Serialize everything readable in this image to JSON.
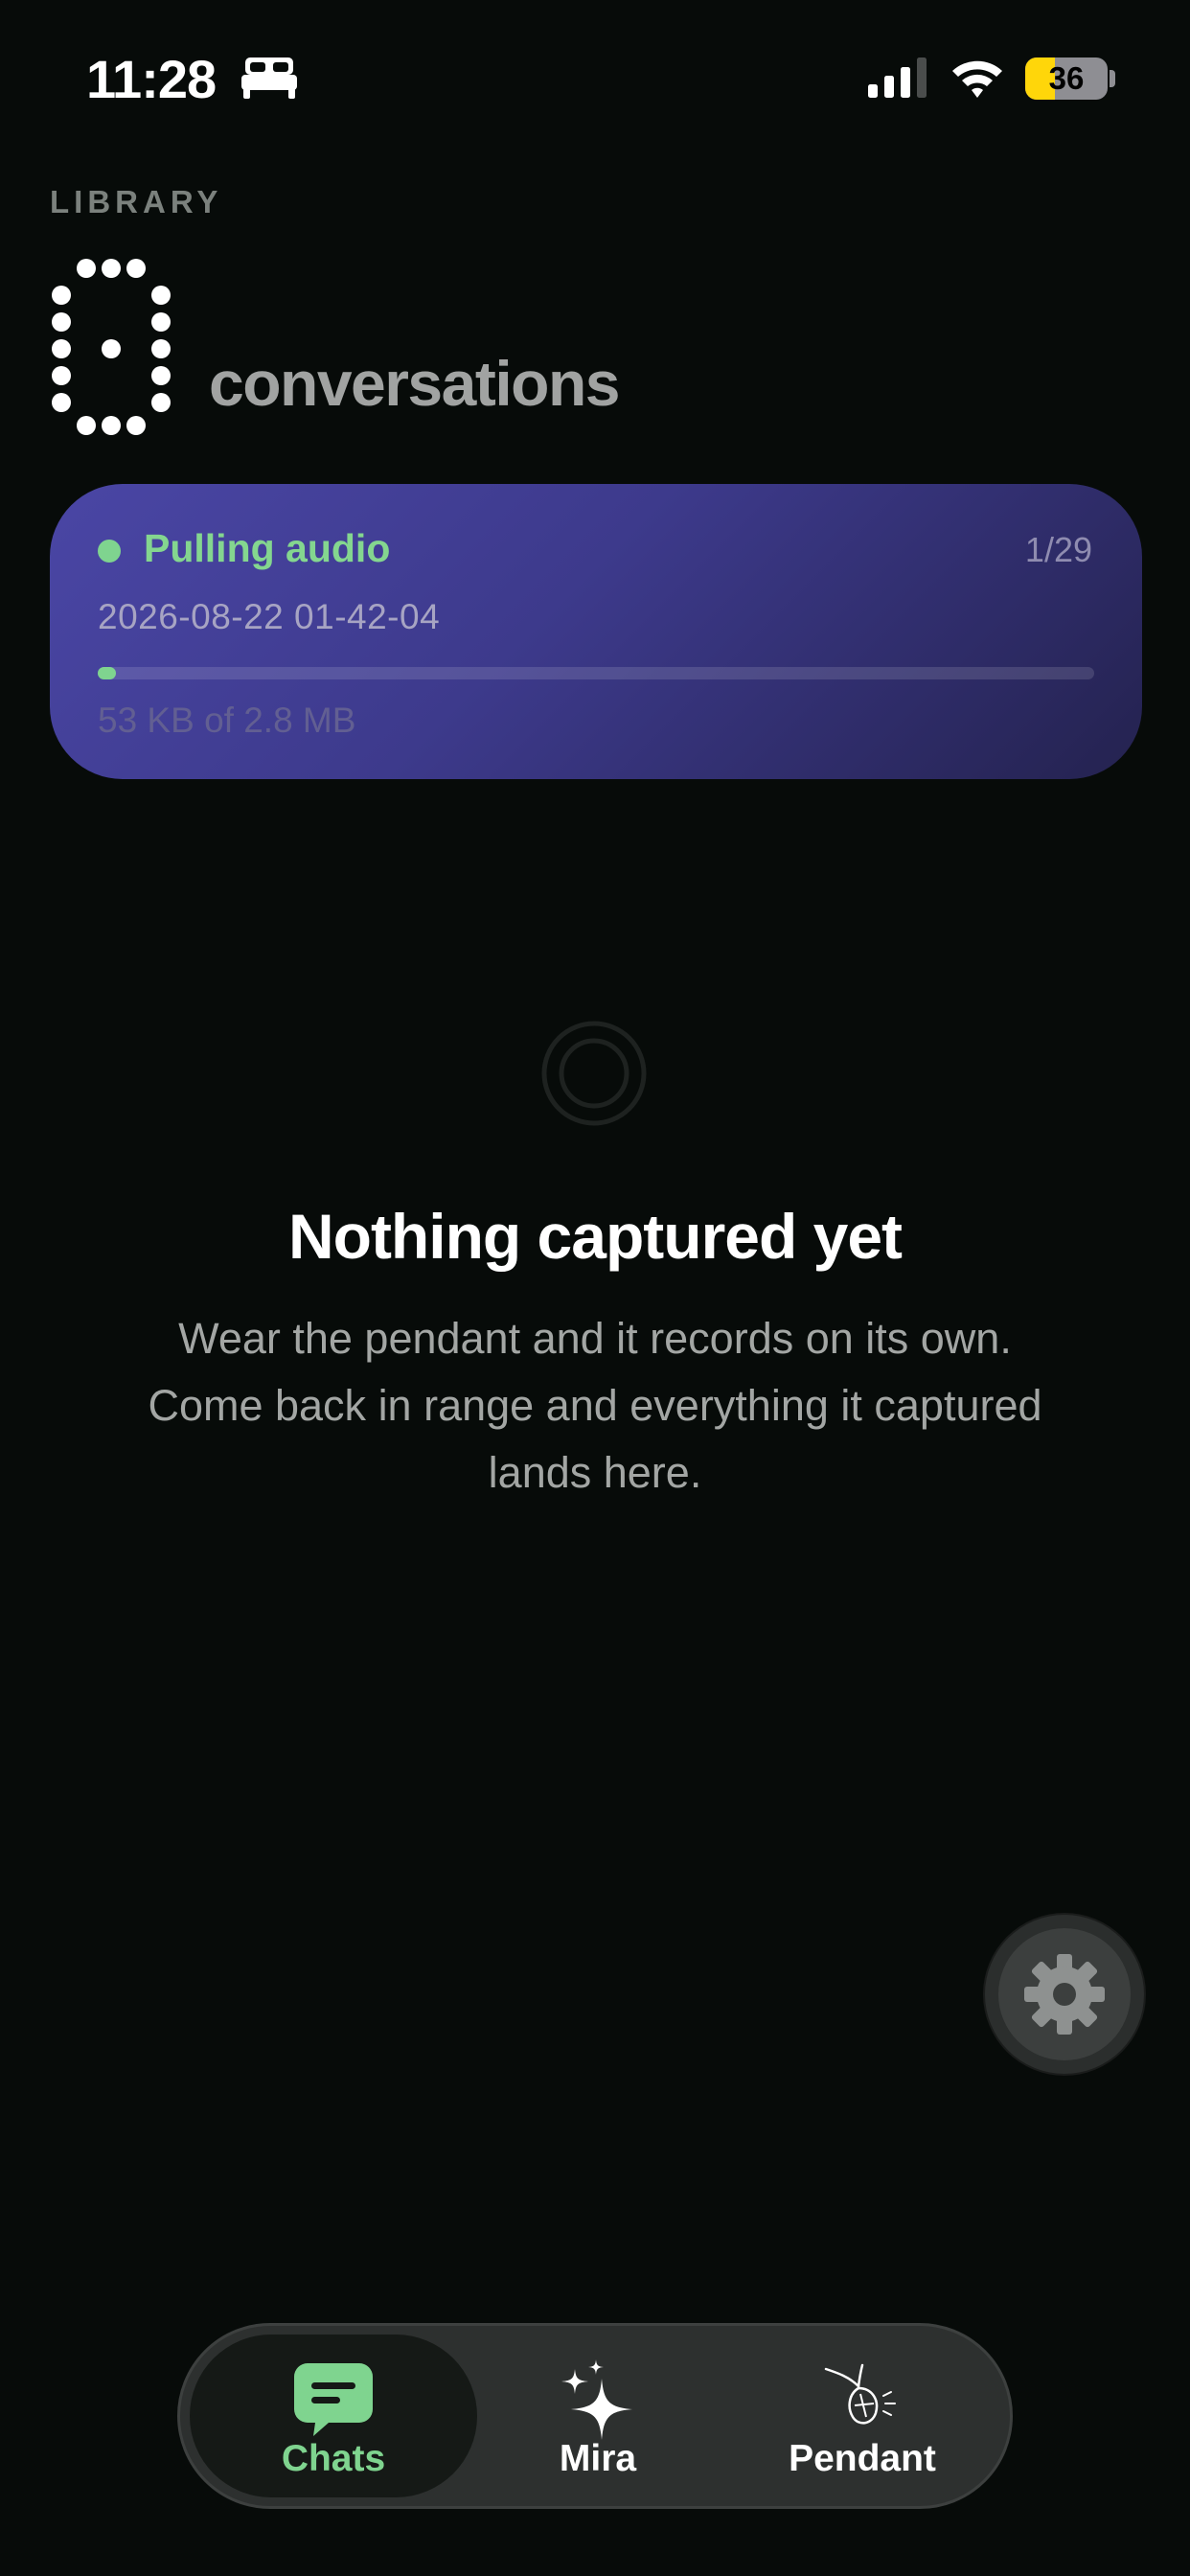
{
  "status_bar": {
    "time": "11:28",
    "battery_level": "36",
    "battery_percent": 36,
    "focus_icon": "bed-icon",
    "signal_icon": "cellular-signal-icon",
    "wifi_icon": "wifi-icon"
  },
  "header": {
    "section_label": "LIBRARY",
    "count_digit": "0",
    "title": "conversations"
  },
  "sync_card": {
    "status": "Pulling audio",
    "progress_label": "1/29",
    "filename": "2026-08-22 01-42-04",
    "bytes_label": "53 KB of 2.8 MB",
    "progress_fraction": 0.018,
    "accent_color": "#7fd48f"
  },
  "empty_state": {
    "icon": "empty-ring-icon",
    "title": "Nothing captured yet",
    "body": "Wear the pendant and it records on its own. Come back in range and everything it captured lands here."
  },
  "fab": {
    "icon": "gear-icon"
  },
  "tab_bar": {
    "tabs": [
      {
        "label": "Chats",
        "icon": "chat-bubble-icon",
        "active": true
      },
      {
        "label": "Mira",
        "icon": "sparkles-icon",
        "active": false
      },
      {
        "label": "Pendant",
        "icon": "pendant-icon",
        "active": false
      }
    ]
  },
  "colors": {
    "background": "#070b09",
    "accent_green": "#7fd48f",
    "card_gradient_start": "#4a46a5",
    "card_gradient_end": "#24224f"
  }
}
